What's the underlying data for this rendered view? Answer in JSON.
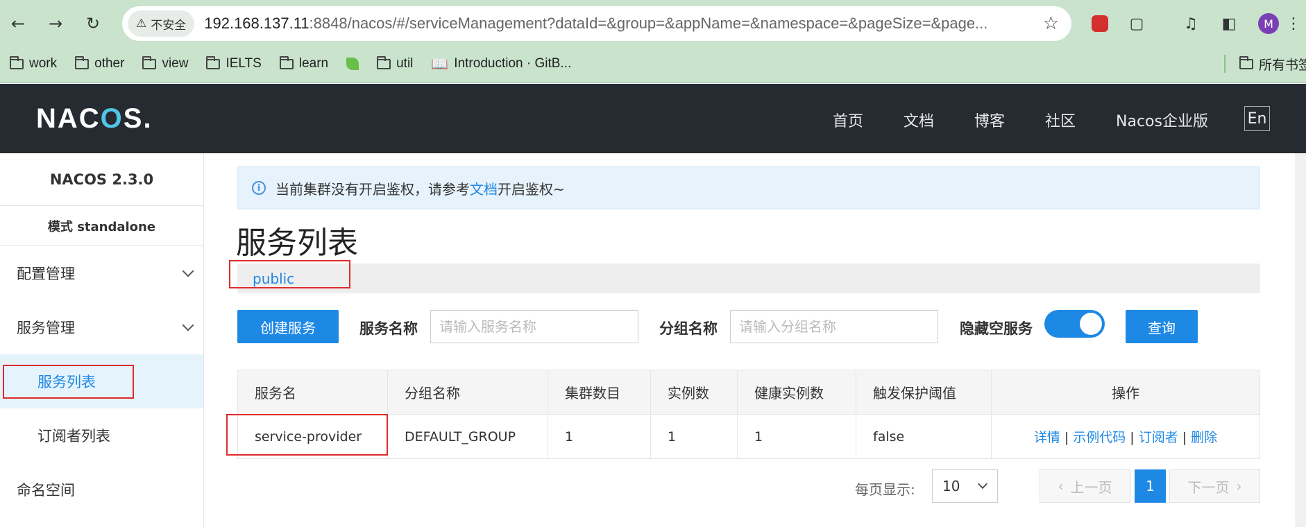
{
  "browser": {
    "security_label": "不安全",
    "url_host": "192.168.137.11",
    "url_rest": ":8848/nacos/#/serviceManagement?dataId=&group=&appName=&namespace=&pageSize=&page...",
    "profile_initial": "M",
    "bookmarks": [
      "work",
      "other",
      "view",
      "IELTS",
      "learn",
      "util",
      "Introduction · GitB..."
    ],
    "all_bookmarks": "所有书签"
  },
  "header": {
    "logo": "NACOS.",
    "nav": [
      "首页",
      "文档",
      "博客",
      "社区",
      "Nacos企业版"
    ],
    "lang": "En"
  },
  "sidebar": {
    "version": "NACOS 2.3.0",
    "mode": "模式 standalone",
    "items": [
      {
        "label": "配置管理"
      },
      {
        "label": "服务管理"
      },
      {
        "label": "服务列表"
      },
      {
        "label": "订阅者列表"
      },
      {
        "label": "命名空间"
      }
    ]
  },
  "alert": {
    "prefix": "当前集群没有开启鉴权，请参考",
    "link": "文档",
    "suffix": "开启鉴权~"
  },
  "page": {
    "title": "服务列表",
    "namespace": "public"
  },
  "filters": {
    "create_button": "创建服务",
    "service_name_label": "服务名称",
    "service_name_placeholder": "请输入服务名称",
    "group_name_label": "分组名称",
    "group_name_placeholder": "请输入分组名称",
    "hide_empty_label": "隐藏空服务",
    "query_button": "查询"
  },
  "table": {
    "headers": [
      "服务名",
      "分组名称",
      "集群数目",
      "实例数",
      "健康实例数",
      "触发保护阈值",
      "操作"
    ],
    "rows": [
      {
        "service": "service-provider",
        "group": "DEFAULT_GROUP",
        "clusters": "1",
        "instances": "1",
        "healthy": "1",
        "threshold": "false",
        "ops": [
          "详情",
          "示例代码",
          "订阅者",
          "删除"
        ]
      }
    ]
  },
  "pagination": {
    "per_page_label": "每页显示:",
    "page_size": "10",
    "prev": "上一页",
    "current": "1",
    "next": "下一页"
  }
}
